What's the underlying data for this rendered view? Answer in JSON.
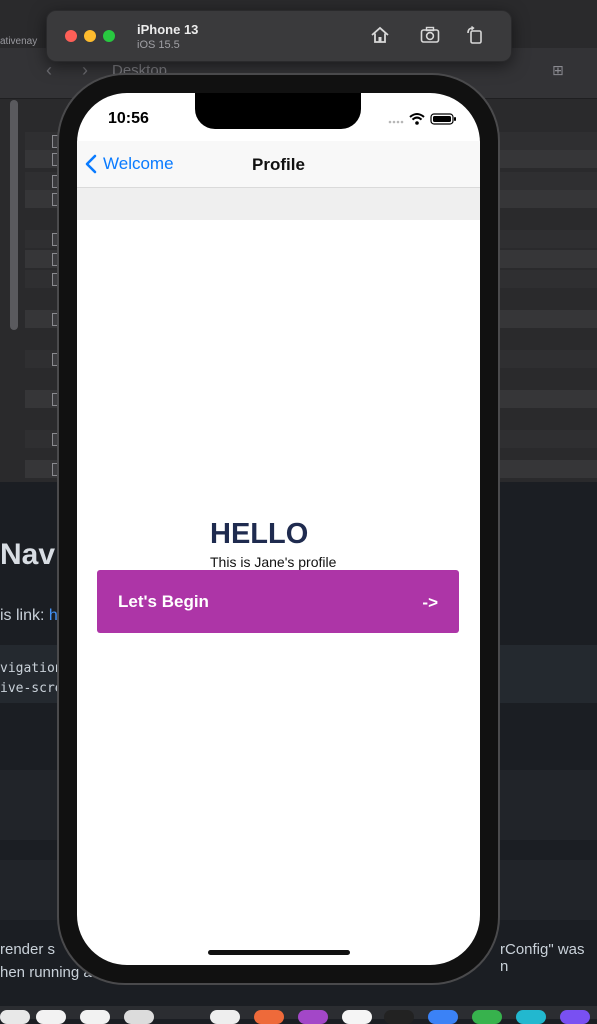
{
  "background": {
    "finder_tab_fragment": "ativenay",
    "finder_title": "Desktop",
    "heading_fragment": "Navi",
    "link_line_prefix": "is link: ",
    "link_fragment": "h",
    "code_lines": [
      "vigation",
      "ive-scre"
    ],
    "bottom_text_left_1": "render s",
    "bottom_text_right": "rConfig\" was n",
    "bottom_text_left_2": "hen running a"
  },
  "simulator": {
    "device_name": "iPhone 13",
    "os_version": "iOS 15.5",
    "controls": [
      "home-icon",
      "screenshot-icon",
      "rotate-icon"
    ]
  },
  "status_bar": {
    "time": "10:56"
  },
  "nav": {
    "back_label": "Welcome",
    "title": "Profile"
  },
  "content": {
    "greeting": "HELLO",
    "profile_text": "This is Jane's profile",
    "button_label": "Let's Begin",
    "button_arrow": "->"
  },
  "colors": {
    "accent_blue": "#0a7bff",
    "button_purple": "#ad35a7",
    "greeting_navy": "#1f2b4f"
  }
}
